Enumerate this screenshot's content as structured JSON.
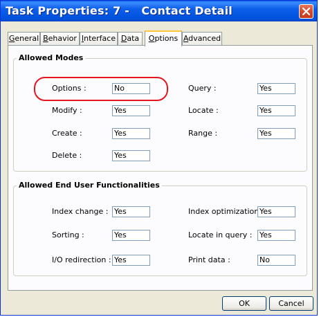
{
  "window": {
    "title": "Task Properties: 7 -   Contact Detail"
  },
  "tabs": [
    {
      "label": "General",
      "key": "G",
      "rest": "eneral"
    },
    {
      "label": "Behavior",
      "key": "B",
      "rest": "ehavior"
    },
    {
      "label": "Interface",
      "key": "I",
      "rest": "nterface"
    },
    {
      "label": "Data",
      "key": "D",
      "rest": "ata"
    },
    {
      "label": "Options",
      "key": "O",
      "rest": "ptions",
      "active": true
    },
    {
      "label": "Advanced",
      "key": "A",
      "rest": "dvanced"
    }
  ],
  "allowed_modes": {
    "title": "Allowed Modes",
    "options_label": "Options :",
    "options_value": "No",
    "modify_label": "Modify :",
    "modify_value": "Yes",
    "create_label": "Create :",
    "create_value": "Yes",
    "delete_label": "Delete :",
    "delete_value": "Yes",
    "query_label": "Query :",
    "query_value": "Yes",
    "locate_label": "Locate :",
    "locate_value": "Yes",
    "range_label": "Range :",
    "range_value": "Yes"
  },
  "end_user": {
    "title": "Allowed End User Functionalities",
    "index_change_label": "Index change :",
    "index_change_value": "Yes",
    "sorting_label": "Sorting :",
    "sorting_value": "Yes",
    "io_label": "I/O redirection :",
    "io_value": "Yes",
    "index_opt_label": "Index optimization :",
    "index_opt_value": "Yes",
    "locate_query_label": "Locate in query :",
    "locate_query_value": "Yes",
    "print_label": "Print data :",
    "print_value": "No"
  },
  "buttons": {
    "ok": "OK",
    "cancel": "Cancel"
  },
  "colors": {
    "titlebar": "#0052de",
    "highlight": "#e6141e",
    "close": "#d3482a"
  }
}
